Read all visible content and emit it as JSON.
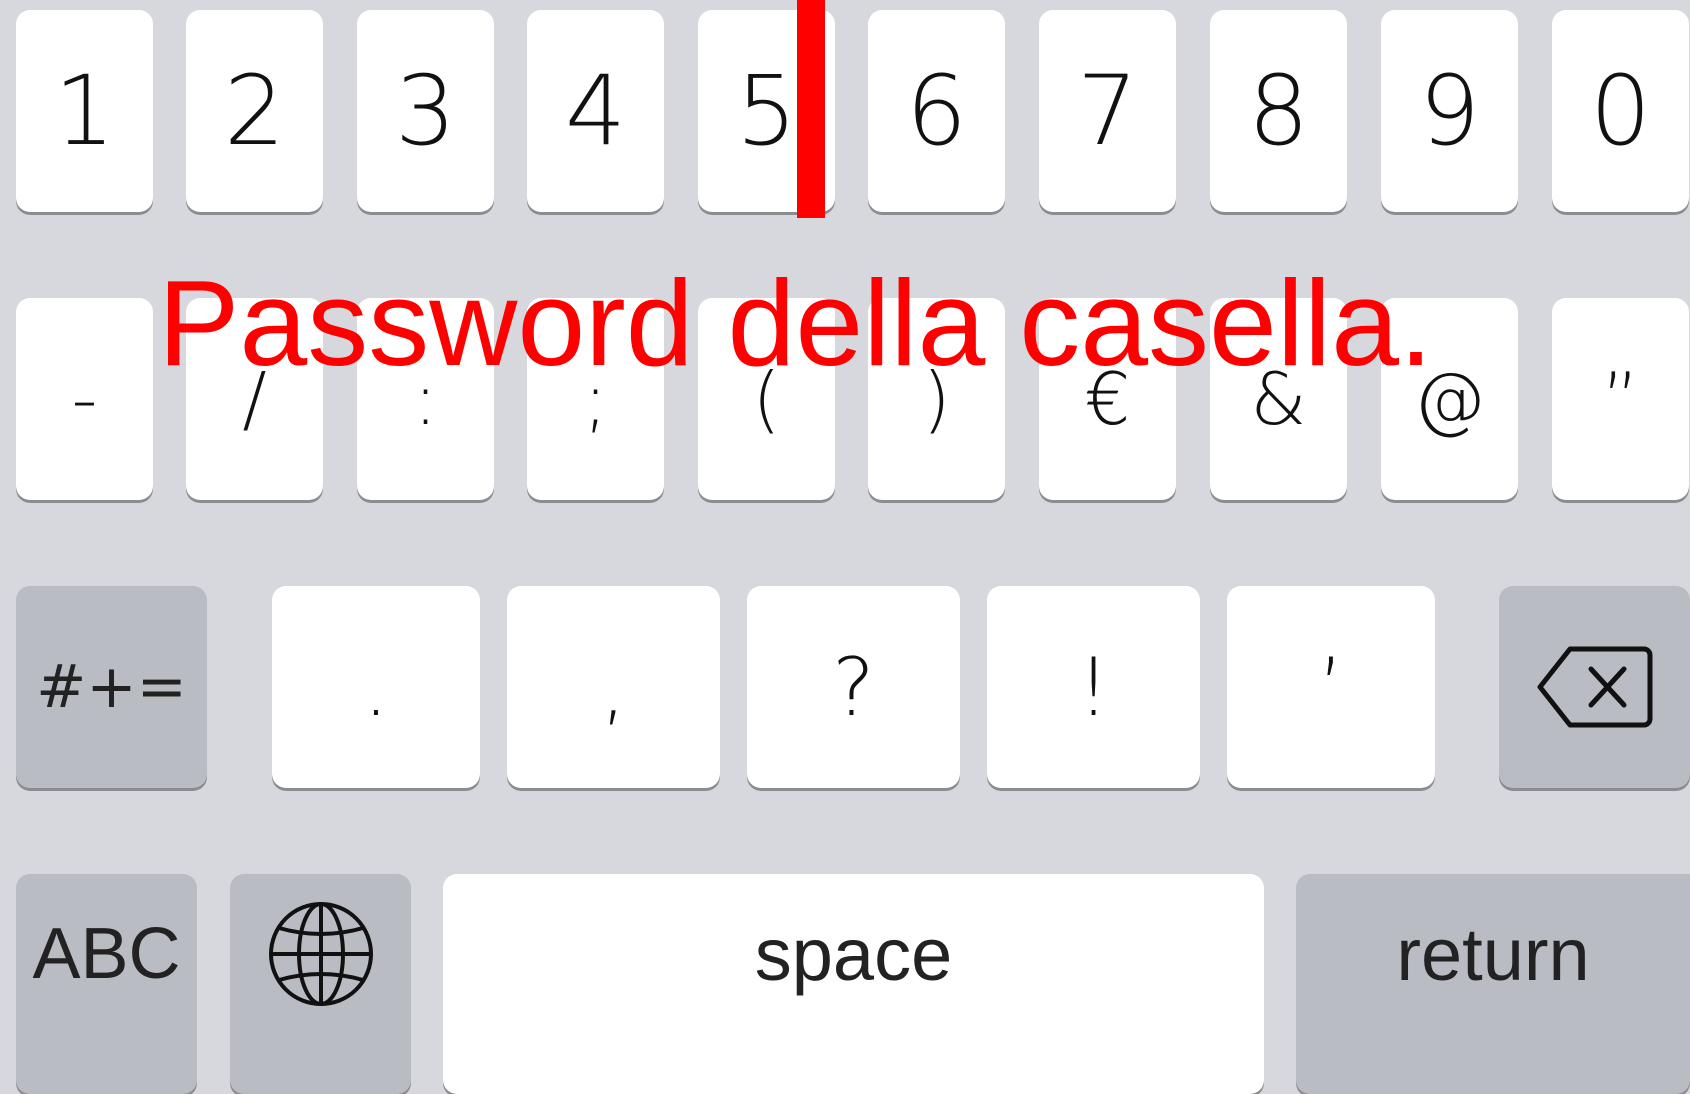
{
  "keyboard": {
    "row1": [
      "1",
      "2",
      "3",
      "4",
      "5",
      "6",
      "7",
      "8",
      "9",
      "0"
    ],
    "row2": [
      "-",
      "/",
      ":",
      ";",
      "(",
      ")",
      "€",
      "&",
      "@",
      "”"
    ],
    "row3": {
      "shift_label": "#+=",
      "punct": [
        ".",
        ",",
        "?",
        "!",
        "’"
      ],
      "delete_icon": "backspace-icon"
    },
    "row4": {
      "abc_label": "ABC",
      "globe_icon": "globe-icon",
      "space_label": "space",
      "return_label": "return"
    }
  },
  "annotation": {
    "text": "Password della casella.",
    "color": "#ff0000"
  },
  "colors": {
    "background": "#d6d8de",
    "key_light": "#ffffff",
    "key_dark": "#b9bcc3",
    "annotation": "#ff0000"
  }
}
